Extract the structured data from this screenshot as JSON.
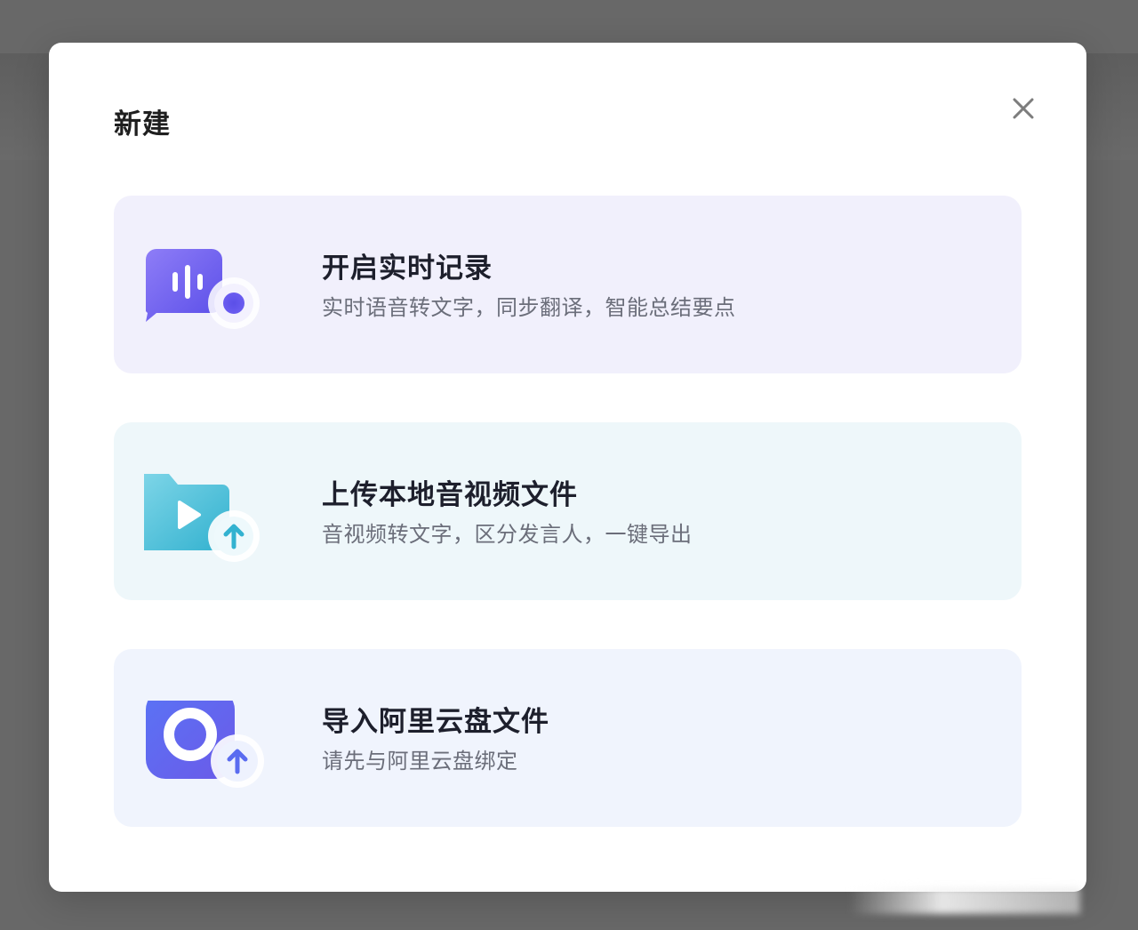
{
  "dialog": {
    "title": "新建",
    "close_icon": "close-icon"
  },
  "options": [
    {
      "id": "live-record",
      "title": "开启实时记录",
      "description": "实时语音转文字，同步翻译，智能总结要点",
      "icon": "microphone-bubble-icon",
      "background": "#f1f0fc",
      "accent": "#6a5cf0"
    },
    {
      "id": "upload-local",
      "title": "上传本地音视频文件",
      "description": "音视频转文字，区分发言人，一键导出",
      "icon": "video-folder-upload-icon",
      "background": "#eef7fa",
      "accent": "#3bb8d6"
    },
    {
      "id": "import-aliyun",
      "title": "导入阿里云盘文件",
      "description": "请先与阿里云盘绑定",
      "icon": "aliyun-drive-upload-icon",
      "background": "#f0f4fd",
      "accent": "#5b6ff2"
    }
  ]
}
